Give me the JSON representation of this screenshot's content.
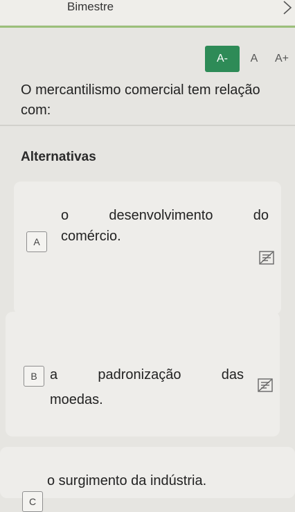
{
  "header": {
    "title": "Bimestre"
  },
  "font_controls": {
    "decrease_label": "A-",
    "normal_label": "A",
    "increase_label": "A+",
    "active_color": "#2e8b57"
  },
  "question": {
    "text": "O mercantilismo comercial tem relação com:"
  },
  "alternatives": {
    "title": "Alternativas",
    "items": [
      {
        "letter": "A",
        "text_line1": "o desenvolvimento do",
        "text_line2": "comércio."
      },
      {
        "letter": "B",
        "text_line1": "a padronização das",
        "text_line2": "moedas."
      },
      {
        "letter": "C",
        "text_line1": "o surgimento da indústria."
      }
    ]
  },
  "icons": {
    "back": "chevron-right-icon",
    "eliminate": "strikethrough-text-icon"
  }
}
